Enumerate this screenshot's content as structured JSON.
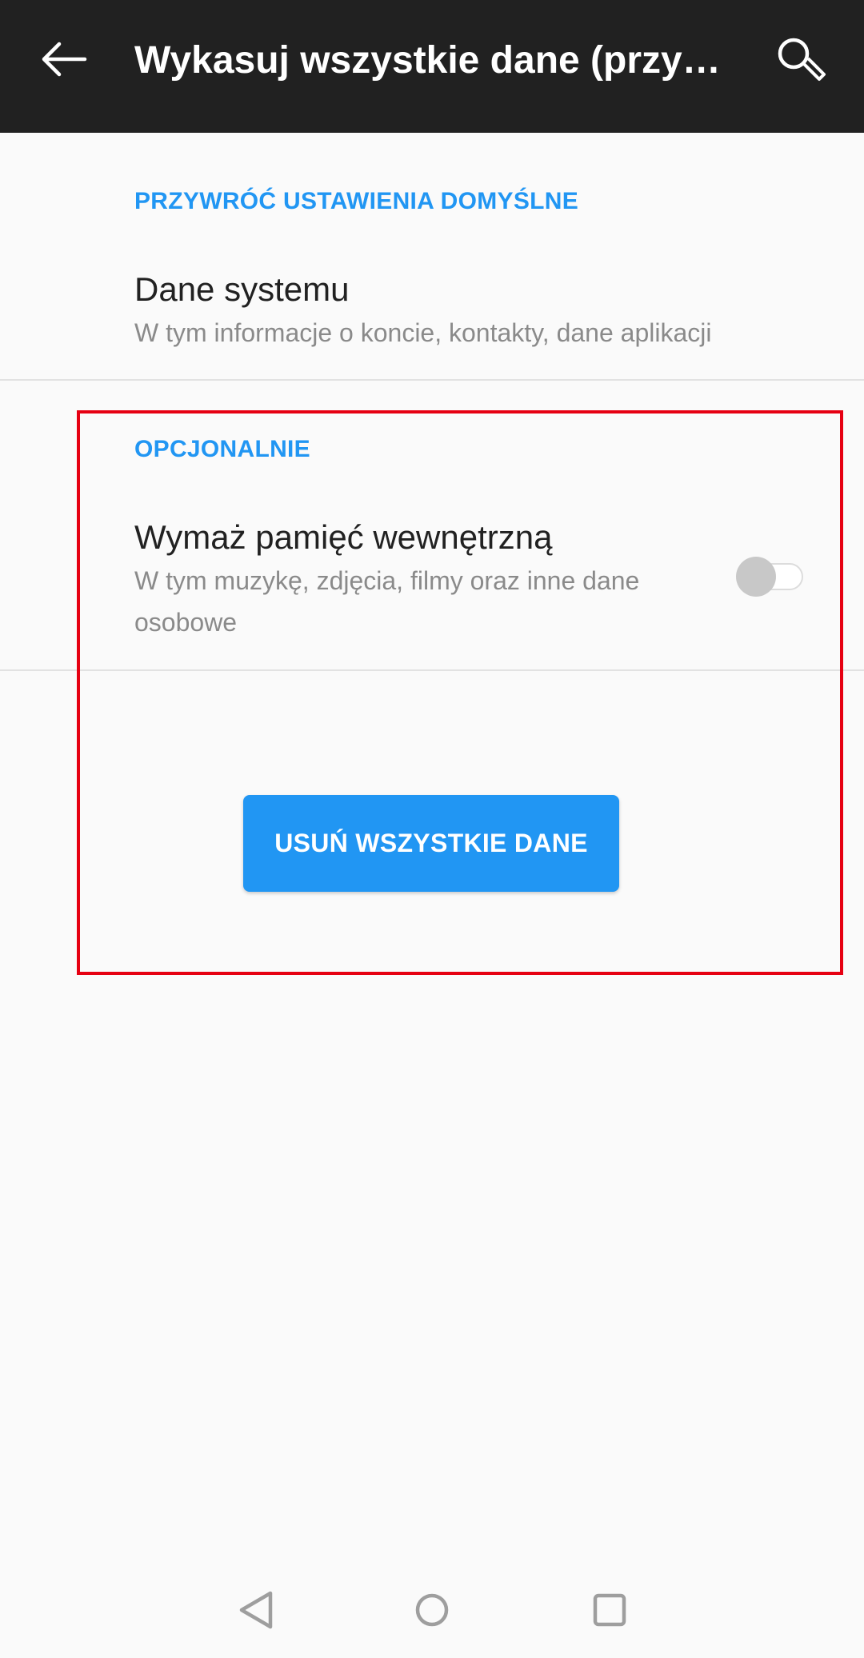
{
  "appbar": {
    "title": "Wykasuj wszystkie dane (przywróć ustawienia fabryczne)",
    "back_icon": "arrow-back-icon",
    "search_icon": "search-icon",
    "background": "#212121"
  },
  "section_reset": {
    "header": "PRZYWRÓĆ USTAWIENIA DOMYŚLNE",
    "item": {
      "title": "Dane systemu",
      "summary": "W tym informacje o koncie, kontakty, dane aplikacji"
    }
  },
  "section_optional": {
    "header": "OPCJONALNIE",
    "item": {
      "title": "Wymaż pamięć wewnętrzną",
      "summary_line1": "W tym muzykę, zdjęcia, filmy oraz inne dane",
      "summary_line2": "osobowe",
      "toggle_on": false
    }
  },
  "primary_button": {
    "label": "USUŃ WSZYSTKIE DANE",
    "color": "#2196f3"
  },
  "navbar": {
    "back_icon": "nav-back-triangle-icon",
    "home_icon": "nav-home-circle-icon",
    "recents_icon": "nav-recents-square-icon"
  },
  "colors": {
    "accent": "#2196f3",
    "highlight": "#e60012"
  }
}
